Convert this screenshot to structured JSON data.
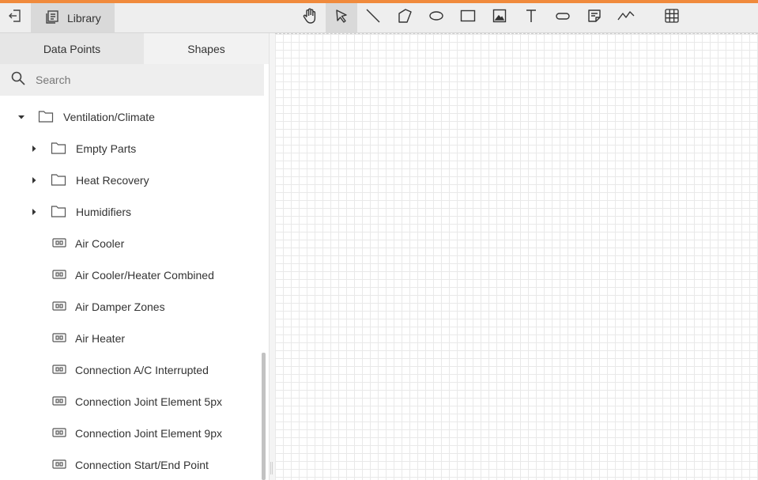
{
  "colors": {
    "accent": "#f08a3c",
    "toolbar_bg": "#eeeeee",
    "active_bg": "#d9d9d9"
  },
  "toolbar": {
    "back_icon": "exit-left-icon",
    "library_label": "Library",
    "library_icon": "library-book-icon",
    "tools": [
      {
        "name": "hand-tool",
        "icon": "hand-icon",
        "active": false
      },
      {
        "name": "select-tool",
        "icon": "pointer-icon",
        "active": true
      },
      {
        "name": "line-tool",
        "icon": "line-icon",
        "active": false
      },
      {
        "name": "polygon-tool",
        "icon": "polygon-icon",
        "active": false
      },
      {
        "name": "ellipse-tool",
        "icon": "ellipse-icon",
        "active": false
      },
      {
        "name": "rectangle-tool",
        "icon": "rectangle-icon",
        "active": false
      },
      {
        "name": "image-tool",
        "icon": "image-icon",
        "active": false
      },
      {
        "name": "text-tool",
        "icon": "text-icon",
        "active": false
      },
      {
        "name": "button-tool",
        "icon": "pill-icon",
        "active": false
      },
      {
        "name": "note-tool",
        "icon": "note-icon",
        "active": false
      },
      {
        "name": "trend-tool",
        "icon": "trend-icon",
        "active": false
      },
      {
        "name": "grid-tool",
        "icon": "grid-icon",
        "active": false
      }
    ]
  },
  "sidebar": {
    "tabs": [
      {
        "label": "Data Points",
        "active": false
      },
      {
        "label": "Shapes",
        "active": true
      }
    ],
    "search": {
      "placeholder": "Search",
      "value": ""
    },
    "tree": [
      {
        "label": "Ventilation/Climate",
        "type": "folder",
        "expanded": true,
        "level": 0
      },
      {
        "label": "Empty Parts",
        "type": "folder",
        "expanded": false,
        "level": 1
      },
      {
        "label": "Heat Recovery",
        "type": "folder",
        "expanded": false,
        "level": 1
      },
      {
        "label": "Humidifiers",
        "type": "folder",
        "expanded": false,
        "level": 1
      },
      {
        "label": "Air Cooler",
        "type": "shape",
        "level": 1
      },
      {
        "label": "Air Cooler/Heater Combined",
        "type": "shape",
        "level": 1
      },
      {
        "label": "Air Damper Zones",
        "type": "shape",
        "level": 1
      },
      {
        "label": "Air Heater",
        "type": "shape",
        "level": 1
      },
      {
        "label": "Connection A/C Interrupted",
        "type": "shape",
        "level": 1
      },
      {
        "label": "Connection Joint Element 5px",
        "type": "shape",
        "level": 1
      },
      {
        "label": "Connection Joint Element 9px",
        "type": "shape",
        "level": 1
      },
      {
        "label": "Connection Start/End Point",
        "type": "shape",
        "level": 1
      }
    ]
  }
}
